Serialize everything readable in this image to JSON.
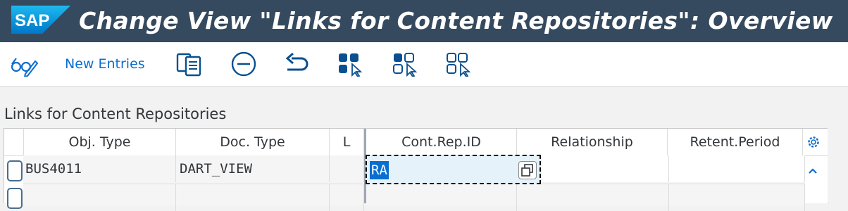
{
  "window": {
    "logo_text": "SAP",
    "title": "Change View \"Links for Content Repositories\": Overview"
  },
  "toolbar": {
    "items": [
      {
        "name": "display-change-icon",
        "label": ""
      },
      {
        "name": "new-entries-button",
        "label": "New Entries"
      },
      {
        "name": "copy-as-icon",
        "label": ""
      },
      {
        "name": "delete-icon",
        "label": ""
      },
      {
        "name": "undo-change-icon",
        "label": ""
      },
      {
        "name": "select-all-icon",
        "label": ""
      },
      {
        "name": "select-block-icon",
        "label": ""
      },
      {
        "name": "deselect-all-icon",
        "label": ""
      }
    ]
  },
  "section": {
    "title": "Links for Content Repositories"
  },
  "table": {
    "columns": [
      "Obj. Type",
      "Doc. Type",
      "L",
      "Cont.Rep.ID",
      "Relationship",
      "Retent.Period"
    ],
    "rows": [
      {
        "obj_type": "BUS4011",
        "doc_type": "DART_VIEW",
        "l": "",
        "cont_rep_id": "RA",
        "relationship": "",
        "retent_period": ""
      },
      {
        "obj_type": "",
        "doc_type": "",
        "l": "",
        "cont_rep_id": "",
        "relationship": "",
        "retent_period": ""
      }
    ]
  },
  "colors": {
    "title_bar": "#354a5f",
    "accent": "#0a6ed1",
    "selection": "#0a6ed1"
  }
}
